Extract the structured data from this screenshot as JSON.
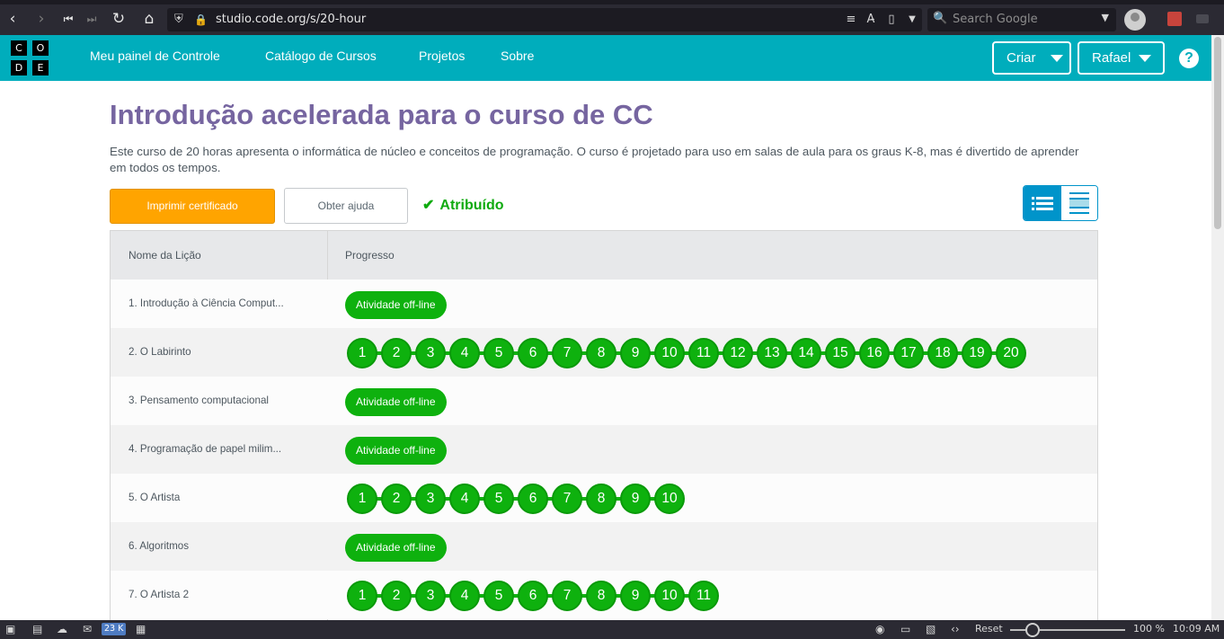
{
  "browser": {
    "url": "studio.code.org/s/20-hour",
    "search_placeholder": "Search Google"
  },
  "header": {
    "logo_letters": [
      "C",
      "O",
      "D",
      "E"
    ],
    "nav": [
      "Meu painel de Controle",
      "Catálogo de Cursos",
      "Projetos",
      "Sobre"
    ],
    "create_label": "Criar",
    "user_label": "Rafael",
    "help_label": "?"
  },
  "page": {
    "title": "Introdução acelerada para o curso de CC",
    "description": "Este curso de 20 horas apresenta o informática de núcleo e conceitos de programação. O curso é projetado para uso em salas de aula para os graus K-8, mas é divertido de aprender em todos os tempos.",
    "print_button": "Imprimir certificado",
    "help_button": "Obter ajuda",
    "assigned_label": "Atribuído"
  },
  "table": {
    "headers": [
      "Nome da Lição",
      "Progresso"
    ],
    "rows": [
      {
        "name": "1. Introdução à Ciência Comput...",
        "offline": "Atividade off-line"
      },
      {
        "name": "2. O Labirinto",
        "levels": [
          "1",
          "2",
          "3",
          "4",
          "5",
          "6",
          "7",
          "8",
          "9",
          "10",
          "11",
          "12",
          "13",
          "14",
          "15",
          "16",
          "17",
          "18",
          "19",
          "20"
        ]
      },
      {
        "name": "3. Pensamento computacional",
        "offline": "Atividade off-line"
      },
      {
        "name": "4. Programação de papel milim...",
        "offline": "Atividade off-line"
      },
      {
        "name": "5. O Artista",
        "levels": [
          "1",
          "2",
          "3",
          "4",
          "5",
          "6",
          "7",
          "8",
          "9",
          "10"
        ]
      },
      {
        "name": "6. Algoritmos",
        "offline": "Atividade off-line"
      },
      {
        "name": "7. O Artista 2",
        "levels": [
          "1",
          "2",
          "3",
          "4",
          "5",
          "6",
          "7",
          "8",
          "9",
          "10",
          "11"
        ]
      }
    ]
  },
  "statusbar": {
    "mail_count": "23 K",
    "reset_label": "Reset",
    "zoom": "100 %",
    "clock": "10:09 AM"
  },
  "colors": {
    "header_bg": "#00adbc",
    "title": "#7665a0",
    "print_button": "#ffa400",
    "progress_green": "#0eb10e",
    "view_toggle": "#0094ca"
  }
}
